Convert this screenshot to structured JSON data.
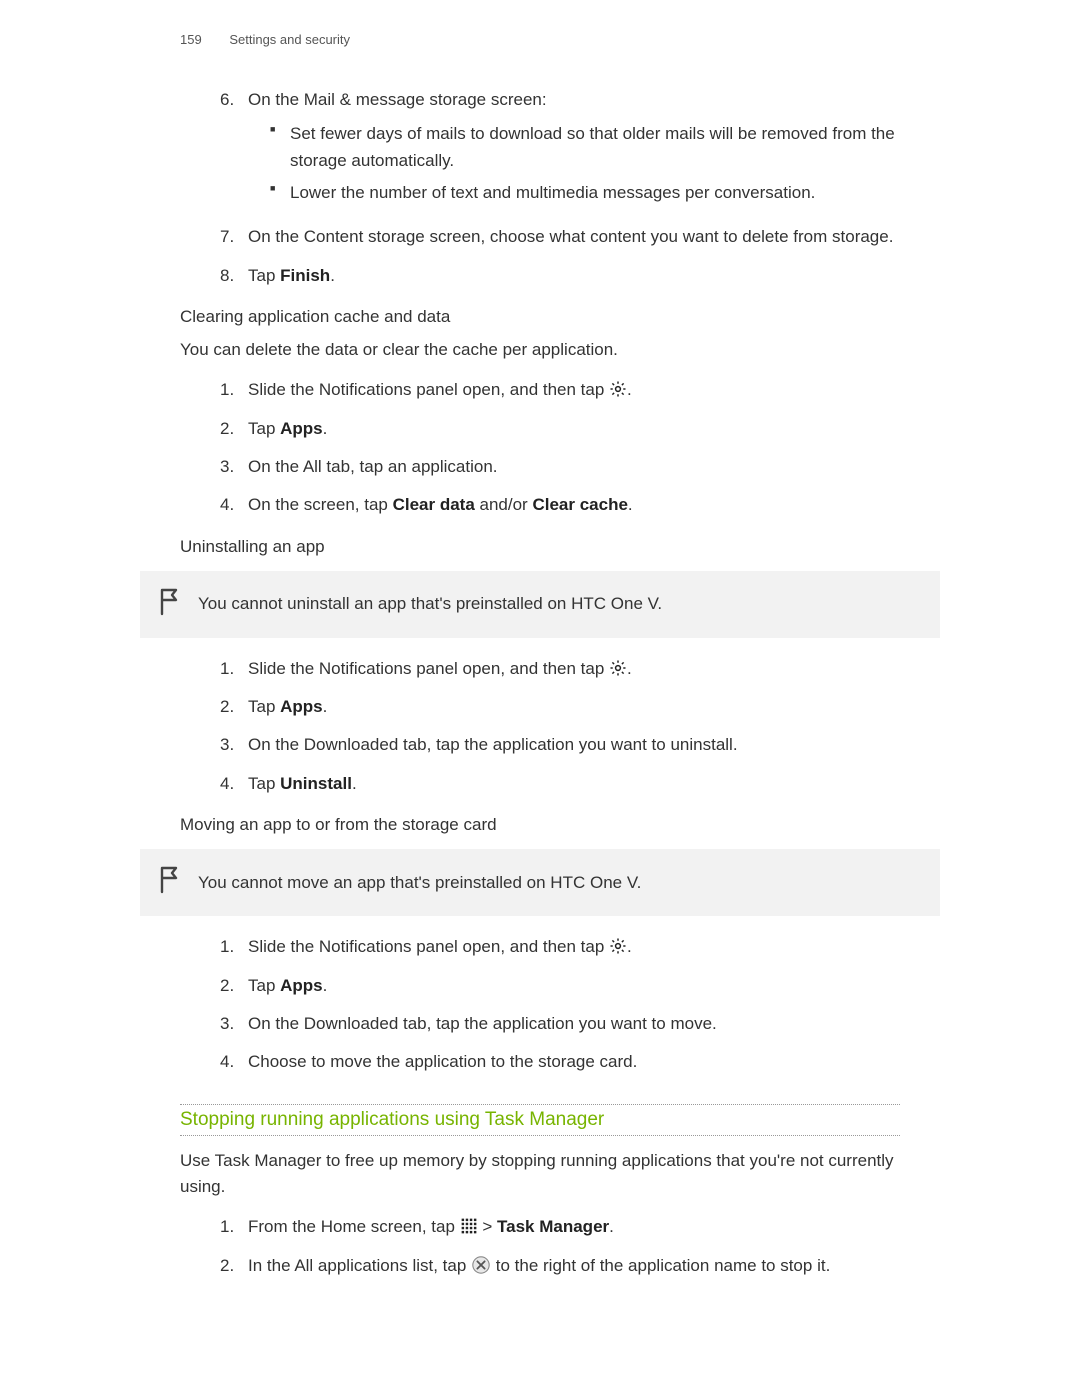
{
  "header": {
    "page_number": "159",
    "section": "Settings and security"
  },
  "steps_top": {
    "s6": {
      "num": "6.",
      "lead": "On the Mail & message storage screen:",
      "bullets": [
        "Set fewer days of mails to download so that older mails will be removed from the storage automatically.",
        "Lower the number of text and multimedia messages per conversation."
      ]
    },
    "s7": {
      "num": "7.",
      "text": "On the Content storage screen, choose what content you want to delete from storage."
    },
    "s8": {
      "num": "8.",
      "pre": "Tap ",
      "bold": "Finish",
      "post": "."
    }
  },
  "clear_cache": {
    "heading": "Clearing application cache and data",
    "intro": "You can delete the data or clear the cache per application.",
    "s1": {
      "num": "1.",
      "pre": "Slide the Notifications panel open, and then tap ",
      "post": "."
    },
    "s2": {
      "num": "2.",
      "pre": "Tap ",
      "bold": "Apps",
      "post": "."
    },
    "s3": {
      "num": "3.",
      "text": "On the All tab, tap an application."
    },
    "s4": {
      "num": "4.",
      "pre": "On the screen, tap ",
      "bold1": "Clear data",
      "mid": " and/or ",
      "bold2": "Clear cache",
      "post": "."
    }
  },
  "uninstall": {
    "heading": "Uninstalling an app",
    "note": "You cannot uninstall an app that's preinstalled on HTC One V.",
    "s1": {
      "num": "1.",
      "pre": "Slide the Notifications panel open, and then tap ",
      "post": "."
    },
    "s2": {
      "num": "2.",
      "pre": "Tap ",
      "bold": "Apps",
      "post": "."
    },
    "s3": {
      "num": "3.",
      "text": "On the Downloaded tab, tap the application you want to uninstall."
    },
    "s4": {
      "num": "4.",
      "pre": "Tap ",
      "bold": "Uninstall",
      "post": "."
    }
  },
  "moving": {
    "heading": "Moving an app to or from the storage card",
    "note": "You cannot move an app that's preinstalled on HTC One V.",
    "s1": {
      "num": "1.",
      "pre": "Slide the Notifications panel open, and then tap ",
      "post": "."
    },
    "s2": {
      "num": "2.",
      "pre": "Tap ",
      "bold": "Apps",
      "post": "."
    },
    "s3": {
      "num": "3.",
      "text": "On the Downloaded tab, tap the application you want to move."
    },
    "s4": {
      "num": "4.",
      "text": "Choose to move the application to the storage card."
    }
  },
  "stopping": {
    "heading": "Stopping running applications using Task Manager",
    "intro": "Use Task Manager to free up memory by stopping running applications that you're not currently using.",
    "s1": {
      "num": "1.",
      "pre": "From the Home screen, tap ",
      "mid": " > ",
      "bold": "Task Manager",
      "post": "."
    },
    "s2": {
      "num": "2.",
      "pre": "In the All applications list, tap ",
      "post": " to the right of the application name to stop it."
    }
  }
}
